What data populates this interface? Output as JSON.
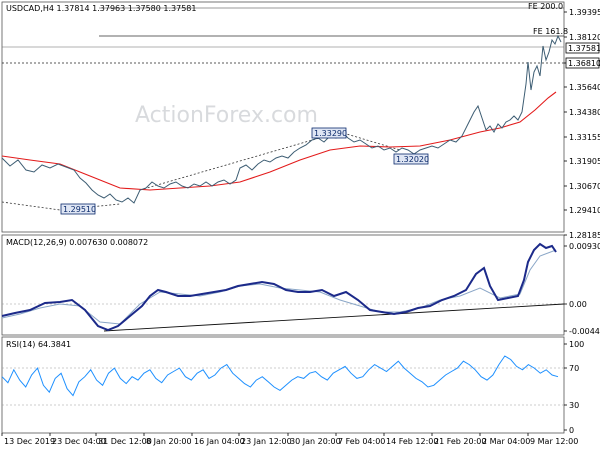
{
  "header": {
    "symbol_info": "USDCAD,H4  1.37814 1.37963 1.37580 1.37581",
    "watermark": "ActionForex.com",
    "corner_label": "FE 200.0"
  },
  "price_panel": {
    "y_ticks": [
      "1.39395",
      "1.38120",
      "1.36810",
      "1.35640",
      "1.34380",
      "1.33155",
      "1.31905",
      "1.30670",
      "1.29410",
      "1.28185"
    ],
    "y_range": [
      1.2795,
      1.3985
    ],
    "current_price": "1.37581",
    "level_1368": "1.36810",
    "fe_label": "FE 161.8",
    "callouts": [
      {
        "label": "1.29510",
        "price": 1.2951
      },
      {
        "label": "1.33290",
        "price": 1.3329
      },
      {
        "label": "1.32020",
        "price": 1.3202
      }
    ],
    "colors": {
      "price": "#3d5d73",
      "ma": "#e31b1b",
      "box_fill": "#dfe6f4",
      "box_border": "#0b2a6b"
    }
  },
  "macd_panel": {
    "title": "MACD(12,26,9) 0.007630 0.008072",
    "y_ticks": [
      "0.009309",
      "0.00",
      "-0.004402"
    ],
    "colors": {
      "macd": "#1c2a8a",
      "signal": "#8aa6c7",
      "trend": "#111111"
    }
  },
  "rsi_panel": {
    "title": "RSI(14) 64.3841",
    "y_ticks": [
      "100",
      "70",
      "30",
      "0"
    ],
    "colors": {
      "rsi": "#1e90ff"
    }
  },
  "x_ticks": [
    "13 Dec 2019",
    "23 Dec 04:00",
    "31 Dec 12:00",
    "8 Jan 20:00",
    "16 Jan 04:00",
    "23 Jan 12:00",
    "30 Jan 20:00",
    "7 Feb 04:00",
    "14 Feb 12:00",
    "21 Feb 20:00",
    "2 Mar 04:00",
    "9 Mar 12:00"
  ]
}
